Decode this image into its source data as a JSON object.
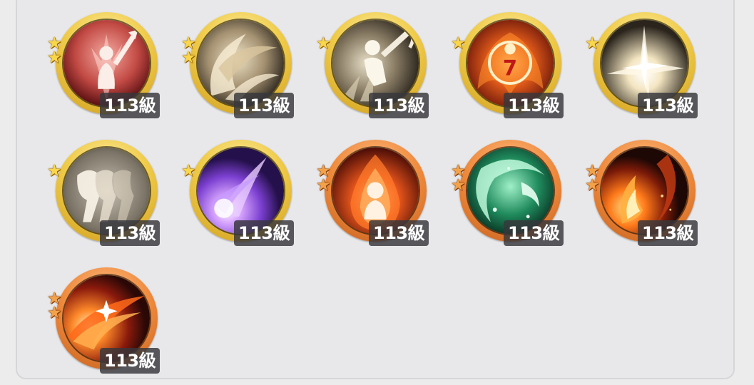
{
  "skills": [
    {
      "id": "skill-1",
      "icon": "sword-raised-figure-icon",
      "level": "113級",
      "tier": "gold",
      "stars": 2,
      "bg": [
        "#e88a84",
        "#8c1f1f"
      ]
    },
    {
      "id": "skill-2",
      "icon": "whirlwind-slash-icon",
      "level": "113級",
      "tier": "gold",
      "stars": 2,
      "bg": [
        "#e9dcc0",
        "#3a2f22"
      ]
    },
    {
      "id": "skill-3",
      "icon": "leaping-blade-icon",
      "level": "113級",
      "tier": "gold",
      "stars": 1,
      "bg": [
        "#e4ddc8",
        "#2b251d"
      ]
    },
    {
      "id": "skill-4",
      "icon": "flame-sigil-icon",
      "level": "113級",
      "tier": "gold",
      "stars": 1,
      "bg": [
        "#ffb24a",
        "#8e1d10"
      ]
    },
    {
      "id": "skill-5",
      "icon": "burst-explosion-icon",
      "level": "113級",
      "tier": "gold",
      "stars": 1,
      "bg": [
        "#fff4d8",
        "#3a3226"
      ]
    },
    {
      "id": "skill-6",
      "icon": "afterimage-dash-icon",
      "level": "113級",
      "tier": "gold",
      "stars": 1,
      "bg": [
        "#d8d2c6",
        "#4a463e"
      ]
    },
    {
      "id": "skill-7",
      "icon": "violet-energy-slash-icon",
      "level": "113級",
      "tier": "gold",
      "stars": 1,
      "bg": [
        "#d9b6ff",
        "#2a0f5a"
      ]
    },
    {
      "id": "skill-8",
      "icon": "fire-aura-figure-icon",
      "level": "113級",
      "tier": "orange",
      "stars": 2,
      "bg": [
        "#ffb060",
        "#7a1a0c"
      ]
    },
    {
      "id": "skill-9",
      "icon": "green-wind-crescent-icon",
      "level": "113級",
      "tier": "orange",
      "stars": 2,
      "bg": [
        "#8fe8b8",
        "#0b3a2a"
      ]
    },
    {
      "id": "skill-10",
      "icon": "fire-crescent-icon",
      "level": "113級",
      "tier": "orange",
      "stars": 2,
      "bg": [
        "#ff9a3a",
        "#2a0c06"
      ]
    },
    {
      "id": "skill-11",
      "icon": "flame-sweep-sparkle-icon",
      "level": "113級",
      "tier": "orange",
      "stars": 2,
      "bg": [
        "#ff9440",
        "#3a0c08"
      ]
    }
  ],
  "colors": {
    "gold_ring": "#f0cc4a",
    "orange_ring": "#ef8a3c",
    "level_badge_bg": "#37373c",
    "panel_bg": "#e8e8ea"
  }
}
